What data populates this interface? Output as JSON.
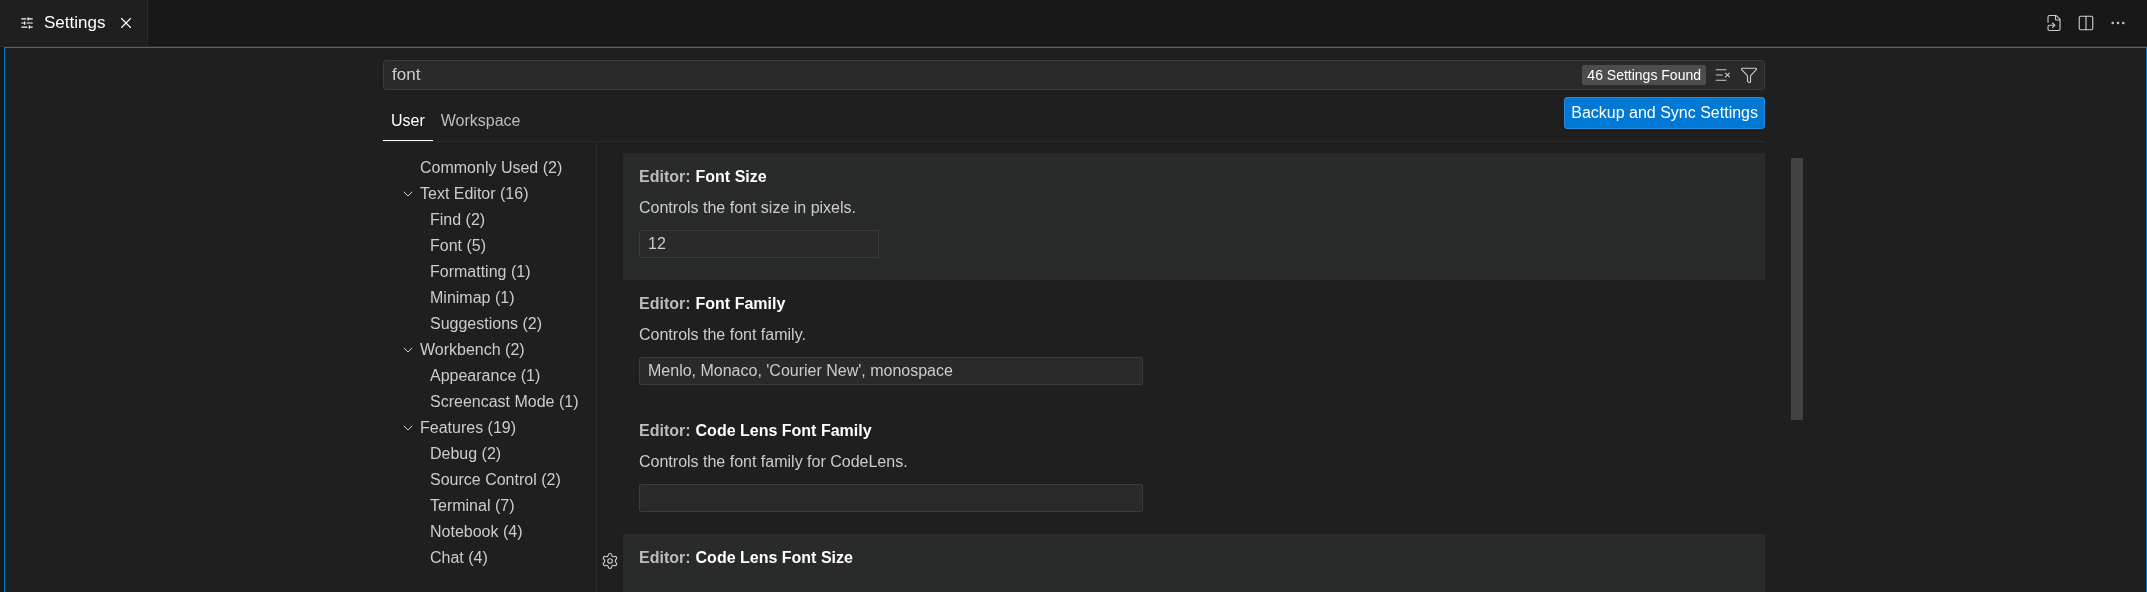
{
  "editor_tabs": [
    {
      "label": "Settings",
      "selected": true
    }
  ],
  "search": {
    "value": "font",
    "result_count": "46 Settings Found"
  },
  "scope_tabs": [
    {
      "label": "User",
      "selected": true
    },
    {
      "label": "Workspace",
      "selected": false
    }
  ],
  "sync_button": "Backup and Sync Settings",
  "toc": [
    {
      "label": "Commonly Used (2)"
    },
    {
      "label": "Text Editor (16)",
      "expanded": true,
      "children": [
        {
          "label": "Find (2)"
        },
        {
          "label": "Font (5)"
        },
        {
          "label": "Formatting (1)"
        },
        {
          "label": "Minimap (1)"
        },
        {
          "label": "Suggestions (2)"
        }
      ]
    },
    {
      "label": "Workbench (2)",
      "expanded": true,
      "children": [
        {
          "label": "Appearance (1)"
        },
        {
          "label": "Screencast Mode (1)"
        }
      ]
    },
    {
      "label": "Features (19)",
      "expanded": true,
      "children": [
        {
          "label": "Debug (2)"
        },
        {
          "label": "Source Control (2)"
        },
        {
          "label": "Terminal (7)"
        },
        {
          "label": "Notebook (4)"
        },
        {
          "label": "Chat (4)"
        }
      ]
    }
  ],
  "settings": [
    {
      "category": "Editor:",
      "name": "Font Size",
      "description": "Controls the font size in pixels.",
      "value": "12",
      "kind": "number",
      "highlighted": true,
      "gear": false
    },
    {
      "category": "Editor:",
      "name": "Font Family",
      "description": "Controls the font family.",
      "value": "Menlo, Monaco, 'Courier New', monospace",
      "kind": "text",
      "highlighted": false,
      "gear": false
    },
    {
      "category": "Editor:",
      "name": "Code Lens Font Family",
      "description": "Controls the font family for CodeLens.",
      "kind": "text",
      "highlighted": false,
      "gear": false
    },
    {
      "category": "Editor:",
      "name": "Code Lens Font Size",
      "highlighted": true,
      "gear": true
    }
  ]
}
